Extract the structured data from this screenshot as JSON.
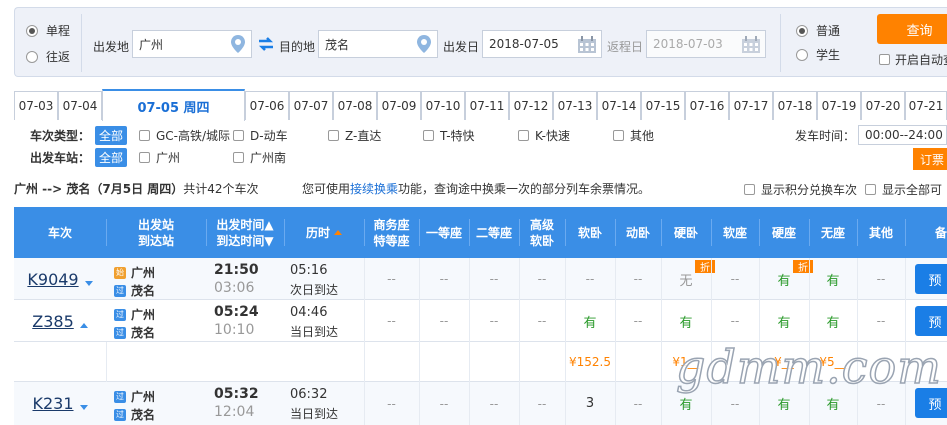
{
  "search": {
    "trip_type": [
      {
        "label": "单程",
        "selected": true
      },
      {
        "label": "往返",
        "selected": false
      }
    ],
    "from_label": "出发地",
    "from_value": "广州",
    "to_label": "目的地",
    "to_value": "茂名",
    "depart_label": "出发日",
    "depart_value": "2018-07-05",
    "return_label": "返程日",
    "return_value": "2018-07-03",
    "passenger_type": [
      {
        "label": "普通",
        "selected": true
      },
      {
        "label": "学生",
        "selected": false
      }
    ],
    "query_label": "查询",
    "auto_query_label": "开启自动查"
  },
  "date_tabs": [
    "07-03",
    "07-04",
    "07-05 周四",
    "07-06",
    "07-07",
    "07-08",
    "07-09",
    "07-10",
    "07-11",
    "07-12",
    "07-13",
    "07-14",
    "07-15",
    "07-16",
    "07-17",
    "07-18",
    "07-19",
    "07-20",
    "07-21"
  ],
  "active_date_index": 2,
  "filters": {
    "train_type_label": "车次类型：",
    "all_label": "全部",
    "train_types": [
      "GC-高铁/城际",
      "D-动车",
      "Z-直达",
      "T-特快",
      "K-快速",
      "其他"
    ],
    "station_label": "出发车站：",
    "stations": [
      "广州",
      "广州南"
    ],
    "depart_time_label": "发车时间：",
    "depart_time_value": "00:00--24:00",
    "subscribe_label": "订票"
  },
  "summary": {
    "route": "广州 --> 茂名（7月5日 周四）",
    "count": "共计42个车次",
    "transfer_prefix": "您可使用",
    "transfer_link": "接续换乘",
    "transfer_suffix": "功能，查询途中换乘一次的部分列车余票情况。",
    "show_points": "显示积分兑换车次",
    "show_all": "显示全部可"
  },
  "table": {
    "headers": {
      "train": "车次",
      "station_top": "出发站",
      "station_bottom": "到达站",
      "time_top": "出发时间▲",
      "time_bottom": "到达时间▼",
      "duration": "历时",
      "business_top": "商务座",
      "business_bottom": "特等座",
      "first": "一等座",
      "second": "二等座",
      "premium_top": "高级",
      "premium_bottom": "软卧",
      "soft_sleeper": "软卧",
      "moving_sleeper": "动卧",
      "hard_sleeper": "硬卧",
      "soft_seat": "软座",
      "hard_seat": "硬座",
      "no_seat": "无座",
      "other": "其他",
      "remark": "备"
    },
    "rows": [
      {
        "train": "K9049",
        "arrow": "down",
        "from_badge": "始",
        "from": "广州",
        "to_badge": "过",
        "to": "茂名",
        "depart": "21:50",
        "arrive": "03:06",
        "duration": "05:16",
        "arrival_note": "次日到达",
        "seats": [
          "--",
          "--",
          "--",
          "--",
          "--",
          "--",
          "无",
          "--",
          "有",
          "有",
          "--"
        ],
        "discount_label": "折",
        "book": "预"
      },
      {
        "train": "Z385",
        "arrow": "up",
        "from_badge": "过",
        "from": "广州",
        "to_badge": "过",
        "to": "茂名",
        "depart": "05:24",
        "arrive": "10:10",
        "duration": "04:46",
        "arrival_note": "当日到达",
        "seats": [
          "--",
          "--",
          "--",
          "--",
          "有",
          "--",
          "有",
          "--",
          "有",
          "有",
          "--"
        ],
        "book": "预"
      },
      {
        "train": "K231",
        "arrow": "down",
        "from_badge": "过",
        "from": "广州",
        "to_badge": "过",
        "to": "茂名",
        "depart": "05:32",
        "arrive": "12:04",
        "duration": "06:32",
        "arrival_note": "当日到达",
        "seats": [
          "--",
          "--",
          "--",
          "--",
          "3",
          "--",
          "有",
          "--",
          "有",
          "有",
          "--"
        ],
        "book": "预"
      }
    ],
    "price_row": {
      "soft_sleeper": "¥152.5",
      "hard_sleeper": "¥1__",
      "hard_seat": "¥__",
      "no_seat": "¥5__"
    }
  },
  "watermark": "gdmm.com",
  "colors": {
    "accent": "#3a8ee6",
    "orange": "#ff8200",
    "available": "#2a9a2a"
  }
}
